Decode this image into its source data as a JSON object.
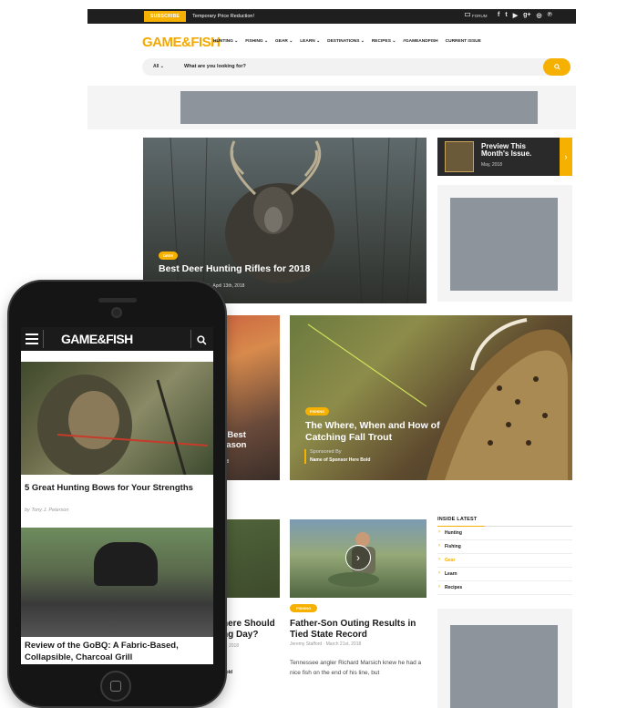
{
  "desktop": {
    "topbar": {
      "subscribe": "SUBSCRIBE",
      "promo": "Temporary Price Reduction!",
      "forum": "FORUM",
      "socials": [
        "f",
        "t",
        "▶",
        "g+",
        "◎",
        "℗"
      ]
    },
    "logo": "GAME&FISH",
    "nav": [
      "HUNTING ⌄",
      "FISHING ⌄",
      "GEAR ⌄",
      "LEARN ⌄",
      "DESTINATIONS ⌄",
      "RECIPES ⌄",
      "#GAMEANDFISH",
      "CURRENT ISSUE"
    ],
    "search": {
      "scope": "All ⌄",
      "placeholder": "What are you looking for?"
    },
    "hero": {
      "badge": "DEER",
      "title": "Best Deer Hunting Rifles for 2018",
      "meta": "Staff · April 13th, 2018"
    },
    "preview": {
      "title": "Preview This Month's Issue.",
      "date": "May, 2018",
      "arrow": "›"
    },
    "mid_left": {
      "title": "r Best\neason",
      "meta": "018"
    },
    "trout": {
      "badge": "FISHING",
      "title": "The Where, When and How of Catching Fall Trout",
      "sponsored": "Sponsored By",
      "sponsor_name": "Name of Sponsor Here Bold"
    },
    "bottom_left": {
      "title": "here Should\nng Day?",
      "date": "th, 2018",
      "sponsor": "Bold"
    },
    "fish_story": {
      "badge": "FISHING",
      "title": "Father-Son Outing Results in Tied State Record",
      "meta": "Jeremy Stafford · March 21st, 2018",
      "excerpt": "Tennessee angler Richard Marsich knew he had a nice fish on the end of his line, but"
    },
    "inside_latest": {
      "heading": "INSIDE LATEST",
      "items": [
        "Hunting",
        "Fishing",
        "Gear",
        "Learn",
        "Recipes"
      ]
    }
  },
  "mobile": {
    "logo": "GAME&FISH",
    "article1": {
      "title": "5 Great Hunting Bows for Your Strengths",
      "author": "by Tony J. Peterson"
    },
    "article2": {
      "title": "Review of the GoBQ: A Fabric-Based, Collapsible, Charcoal Grill"
    }
  },
  "colors": {
    "accent": "#f5b000",
    "dark": "#1f1f1f",
    "ad_placeholder": "#8e949c"
  }
}
